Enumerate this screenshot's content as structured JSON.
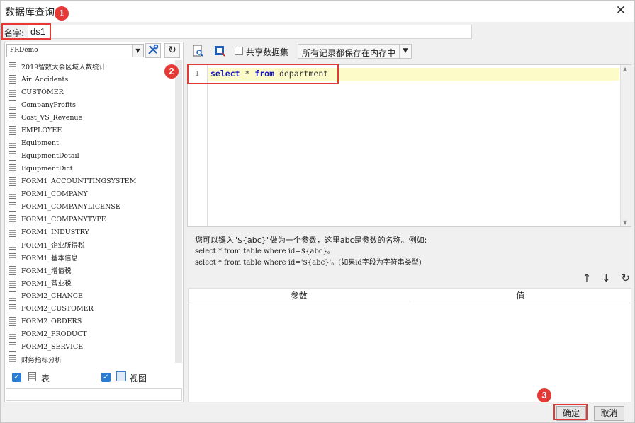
{
  "window": {
    "title": "数据库查询",
    "close_glyph": "✕"
  },
  "name_field": {
    "label": "名字:",
    "value": "ds1"
  },
  "left_panel": {
    "connection": "FRDemo",
    "tables": [
      "2019智数大会区域人数统计",
      "Air_Accidents",
      "CUSTOMER",
      "CompanyProfits",
      "Cost_VS_Revenue",
      "EMPLOYEE",
      "Equipment",
      "EquipmentDetail",
      "EquipmentDict",
      "FORM1_ACCOUNTTINGSYSTEM",
      "FORM1_COMPANY",
      "FORM1_COMPANYLICENSE",
      "FORM1_COMPANYTYPE",
      "FORM1_INDUSTRY",
      "FORM1_企业所得税",
      "FORM1_基本信息",
      "FORM1_增值税",
      "FORM1_营业税",
      "FORM2_CHANCE",
      "FORM2_CUSTOMER",
      "FORM2_ORDERS",
      "FORM2_PRODUCT",
      "FORM2_SERVICE",
      "财务指标分析"
    ],
    "show_tables_label": "表",
    "show_views_label": "视图"
  },
  "toolbar": {
    "share_label": "共享数据集",
    "mode_value": "所有记录都保存在内存中"
  },
  "editor": {
    "line_number": "1",
    "kw_select": "select",
    "star": " * ",
    "kw_from": "from",
    "table": " department"
  },
  "hint": {
    "line1": "您可以键入\"${abc}\"做为一个参数，这里abc是参数的名称。例如:",
    "line2": "select * from table where id=${abc}。",
    "line3": "select * from table where id='${abc}'。(如果id字段为字符串类型)"
  },
  "params_table": {
    "col_param": "参数",
    "col_value": "值"
  },
  "buttons": {
    "ok": "确定",
    "cancel": "取消"
  },
  "annotations": {
    "badge1": "1",
    "badge2": "2",
    "badge3": "3"
  },
  "colors": {
    "accent_red": "#e53935",
    "checkbox_blue": "#2b7cd3",
    "current_line": "#fdfbc7"
  }
}
